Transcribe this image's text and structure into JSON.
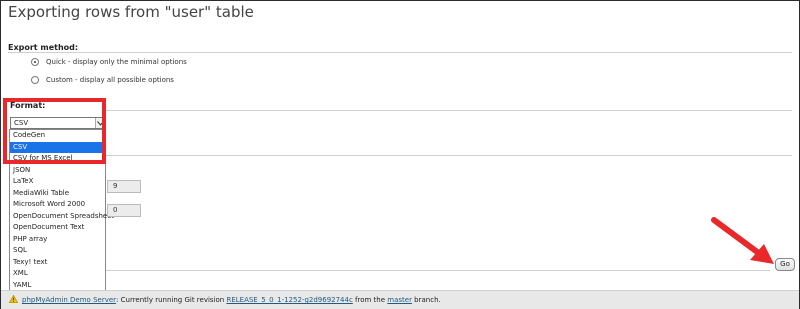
{
  "page": {
    "title": "Exporting rows from \"user\" table"
  },
  "export_method": {
    "heading": "Export method:",
    "options": [
      {
        "label": "Quick - display only the minimal options",
        "checked": true
      },
      {
        "label": "Custom - display all possible options",
        "checked": false
      }
    ]
  },
  "format": {
    "heading": "Format:",
    "selected_value": "CSV",
    "options": [
      "CodeGen",
      "CSV",
      "CSV for MS Excel",
      "JSON",
      "LaTeX",
      "MediaWiki Table",
      "Microsoft Word 2000",
      "OpenDocument Spreadsheet",
      "OpenDocument Text",
      "PHP array",
      "SQL",
      "Texy! text",
      "XML",
      "YAML"
    ],
    "highlighted_option": "CSV"
  },
  "rows": {
    "count_value": "9",
    "start_value": "0"
  },
  "actions": {
    "go_label": "Go"
  },
  "footer": {
    "server_link": "phpMyAdmin Demo Server",
    "text_before_revision": ": Currently running Git revision ",
    "revision_link": "RELEASE_5_0_1-1252-g2d9692744c",
    "text_from": " from the ",
    "branch_link": "master",
    "text_end": " branch."
  },
  "colors": {
    "annotation_red": "#e8282b",
    "selection_blue": "#1a73e8",
    "link_blue": "#235a81"
  }
}
